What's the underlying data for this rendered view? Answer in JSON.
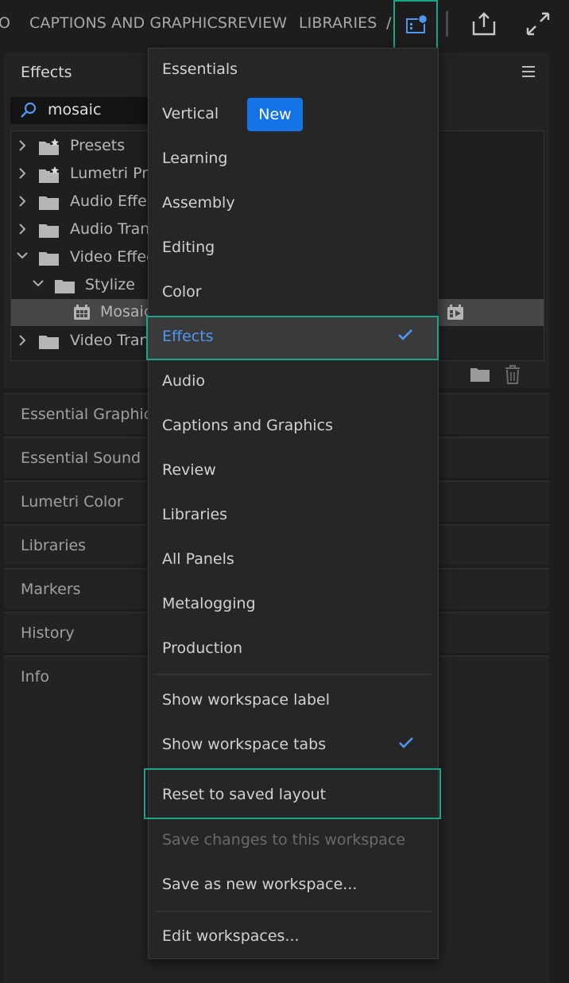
{
  "topbar": {
    "tabs": [
      "O",
      "CAPTIONS AND GRAPHICS",
      "REVIEW",
      "LIBRARIES",
      "/"
    ],
    "workspace_icon": "workspace-switcher-icon",
    "share_icon": "share-icon",
    "fullscreen_icon": "expand-icon"
  },
  "effects_panel": {
    "title": "Effects",
    "search_value": "mosaic",
    "tree": [
      {
        "label": "Presets",
        "icon": "star-folder-icon",
        "level": 0,
        "expanded": false
      },
      {
        "label": "Lumetri Pre",
        "icon": "star-folder-icon",
        "level": 0,
        "expanded": false
      },
      {
        "label": "Audio Effect",
        "icon": "folder-icon",
        "level": 0,
        "expanded": false
      },
      {
        "label": "Audio Trans",
        "icon": "folder-icon",
        "level": 0,
        "expanded": false
      },
      {
        "label": "Video Effect",
        "icon": "folder-icon",
        "level": 0,
        "expanded": true
      },
      {
        "label": "Stylize",
        "icon": "folder-icon",
        "level": 1,
        "expanded": true
      },
      {
        "label": "Mosaic",
        "icon": "effect-icon",
        "level": 2,
        "selected": true
      },
      {
        "label": "Video Trans",
        "icon": "folder-icon",
        "level": 0,
        "expanded": false
      }
    ]
  },
  "panels": [
    "Essential Graphics",
    "Essential Sound",
    "Lumetri Color",
    "Libraries",
    "Markers",
    "History",
    "Info"
  ],
  "menu": {
    "workspaces": [
      {
        "label": "Essentials"
      },
      {
        "label": "Vertical",
        "badge": "New"
      },
      {
        "label": "Learning"
      },
      {
        "label": "Assembly"
      },
      {
        "label": "Editing"
      },
      {
        "label": "Color"
      },
      {
        "label": "Effects",
        "active": true,
        "checked": true
      },
      {
        "label": "Audio"
      },
      {
        "label": "Captions and Graphics"
      },
      {
        "label": "Review"
      },
      {
        "label": "Libraries"
      },
      {
        "label": "All Panels"
      },
      {
        "label": "Metalogging"
      },
      {
        "label": "Production"
      }
    ],
    "options": [
      {
        "label": "Show workspace label"
      },
      {
        "label": "Show workspace tabs",
        "checked": true
      },
      {
        "label": "Reset to saved layout"
      },
      {
        "label": "Save changes to this workspace",
        "disabled": true
      },
      {
        "label": "Save as new workspace..."
      }
    ],
    "edit": {
      "label": "Edit workspaces..."
    }
  },
  "colors": {
    "accent": "#4f97f3",
    "highlight_box": "#1aa58a",
    "badge": "#1473e6"
  }
}
